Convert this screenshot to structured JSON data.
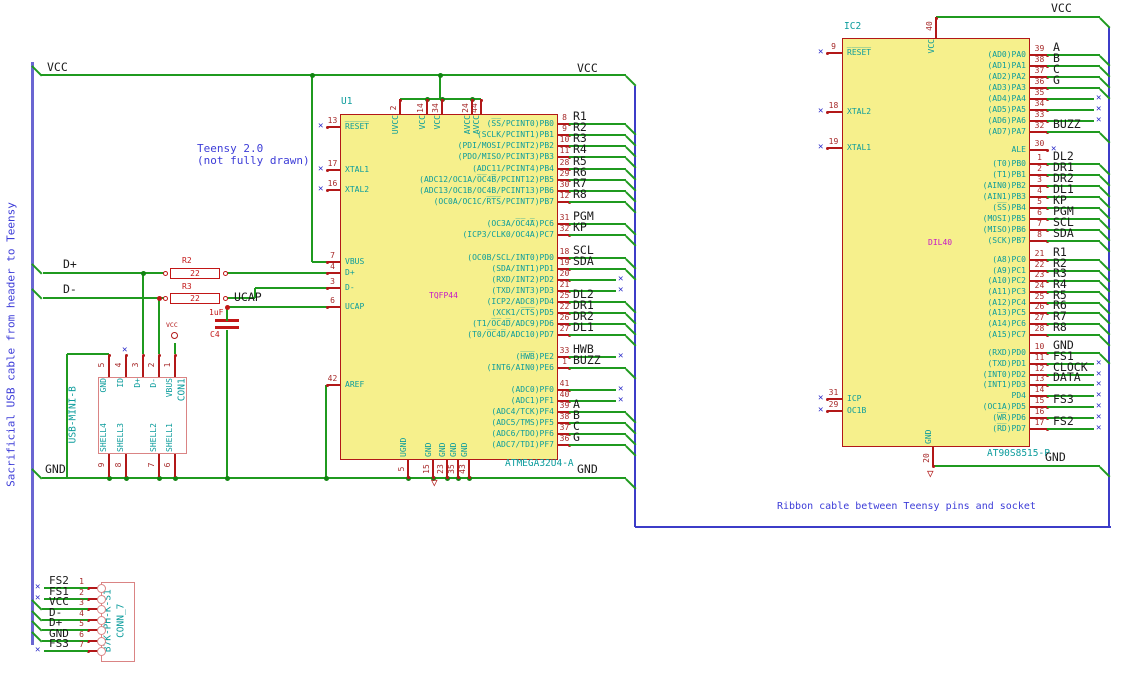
{
  "colors": {
    "wire": "#1f9a1f",
    "junction": "#128412",
    "bus": "#3c3cc8",
    "cable_bus": "#6a66d2",
    "outline": "#b21818",
    "fill": "#f6f08c",
    "pin_name": "#0c9c9c",
    "pin_number": "#a62929",
    "label": "#1a1a1a",
    "note": "#3d3dd8",
    "magenta": "#c617c6",
    "passive": "#c21616",
    "connector": "#da8484",
    "noconnect": "#2a2ac8"
  },
  "notes": {
    "cable": "Sacrificial USB cable from header to Teensy",
    "teensy_line1": "Teensy 2.0",
    "teensy_line2": "(not fully drawn)",
    "ribbon": "Ribbon cable between Teensy pins and socket"
  },
  "net_labels": [
    "VCC",
    "VCC",
    "VCC",
    "GND",
    "GND",
    "GND",
    "D+",
    "D-",
    "UCAP"
  ],
  "u1": {
    "ref": "U1",
    "value": "ATMEGA32U4-A",
    "package": "TQFP44",
    "pins_left": [
      {
        "n": "13",
        "name": "R̅E̅S̅E̅T̅",
        "nc": true
      },
      {
        "n": "17",
        "name": "XTAL1",
        "nc": true
      },
      {
        "n": "16",
        "name": "XTAL2",
        "nc": true
      },
      {
        "n": "7",
        "name": "VBUS"
      },
      {
        "n": "4",
        "name": "D+"
      },
      {
        "n": "3",
        "name": "D-"
      },
      {
        "n": "6",
        "name": "UCAP"
      },
      {
        "n": "42",
        "name": "AREF"
      }
    ],
    "pins_right": [
      {
        "n": "8",
        "name": "(S̅S̅/PCINT0)PB0",
        "label": "R1"
      },
      {
        "n": "9",
        "name": "(SCLK/PCINT1)PB1",
        "label": "R2"
      },
      {
        "n": "10",
        "name": "(PDI/MOSI/PCINT2)PB2",
        "label": "R3"
      },
      {
        "n": "11",
        "name": "(PDO/MISO/PCINT3)PB3",
        "label": "R4"
      },
      {
        "n": "28",
        "name": "(ADC11/PCINT4)PB4",
        "label": "R5"
      },
      {
        "n": "29",
        "name": "(ADC12/OC1A/O̅C̅4̅B̅/PCINT12)PB5",
        "label": "R6"
      },
      {
        "n": "30",
        "name": "(ADC13/OC1B/OC4B/PCINT13)PB6",
        "label": "R7"
      },
      {
        "n": "12",
        "name": "(OC0A/OC1C/R̅T̅S̅/PCINT7)PB7",
        "label": "R8"
      },
      {
        "n": "31",
        "name": "(OC3A/O̅C̅4̅A̅)PC6",
        "label": "PGM"
      },
      {
        "n": "32",
        "name": "(ICP3/CLK0/OC4A)PC7",
        "label": "KP"
      },
      {
        "n": "18",
        "name": "(OC0B/SCL/INT0)PD0",
        "label": "SCL"
      },
      {
        "n": "19",
        "name": "(SDA/INT1)PD1",
        "label": "SDA"
      },
      {
        "n": "20",
        "name": "(RXD/INT2)PD2",
        "nc": true
      },
      {
        "n": "21",
        "name": "(TXD/INT3)PD3",
        "nc": true
      },
      {
        "n": "25",
        "name": "(ICP2/ADC8)PD4",
        "label": "DL2"
      },
      {
        "n": "22",
        "name": "(XCK1/C̅T̅S̅)PD5",
        "label": "DR1"
      },
      {
        "n": "26",
        "name": "(T1/O̅C̅4̅D̅/ADC9)PD6",
        "label": "DR2"
      },
      {
        "n": "27",
        "name": "(T0/O̅C̅4̅D̅/ADC10)PD7",
        "label": "DL1"
      },
      {
        "n": "33",
        "name": "(H̅W̅B̅)PE2",
        "label": "HWB",
        "nc": true
      },
      {
        "n": "1",
        "name": "(INT6/AIN0)PE6",
        "label": "BUZZ"
      },
      {
        "n": "41",
        "name": "(ADC0)PF0",
        "nc": true
      },
      {
        "n": "40",
        "name": "(ADC1)PF1",
        "nc": true
      },
      {
        "n": "39",
        "name": "(ADC4/TCK)PF4",
        "label": "A"
      },
      {
        "n": "38",
        "name": "(ADC5/TMS)PF5",
        "label": "B"
      },
      {
        "n": "37",
        "name": "(ADC6/TDO)PF6",
        "label": "C"
      },
      {
        "n": "36",
        "name": "(ADC7/TDI)PF7",
        "label": "G"
      }
    ],
    "pins_top": [
      {
        "n": "2",
        "name": "UVCC"
      },
      {
        "n": "14",
        "name": "VCC"
      },
      {
        "n": "34",
        "name": "VCC"
      },
      {
        "n": "24",
        "name": "AVCC"
      },
      {
        "n": "44",
        "name": "AVCC"
      }
    ],
    "pins_bottom": [
      {
        "n": "5",
        "name": "UGND"
      },
      {
        "n": "15",
        "name": "GND"
      },
      {
        "n": "23",
        "name": "GND"
      },
      {
        "n": "35",
        "name": "GND"
      },
      {
        "n": "43",
        "name": "GND"
      }
    ]
  },
  "ic2": {
    "ref": "IC2",
    "value": "AT90S8515-P",
    "package": "DIL40",
    "pins_left": [
      {
        "n": "9",
        "name": "R̅E̅S̅E̅T̅",
        "nc": true
      },
      {
        "n": "18",
        "name": "XTAL2",
        "nc": true
      },
      {
        "n": "19",
        "name": "XTAL1",
        "nc": true
      },
      {
        "n": "31",
        "name": "ICP",
        "nc": true
      },
      {
        "n": "29",
        "name": "OC1B",
        "nc": true
      }
    ],
    "pins_top": [
      {
        "n": "40",
        "name": "VCC"
      }
    ],
    "pins_bottom": [
      {
        "n": "20",
        "name": "GND"
      }
    ],
    "pins_right": [
      {
        "n": "39",
        "name": "(AD0)PA0",
        "label": "A"
      },
      {
        "n": "38",
        "name": "(AD1)PA1",
        "label": "B"
      },
      {
        "n": "37",
        "name": "(AD2)PA2",
        "label": "C"
      },
      {
        "n": "36",
        "name": "(AD3)PA3",
        "label": "G"
      },
      {
        "n": "35",
        "name": "(AD4)PA4",
        "nc": true
      },
      {
        "n": "34",
        "name": "(AD5)PA5",
        "nc": true
      },
      {
        "n": "33",
        "name": "(AD6)PA6",
        "nc": true
      },
      {
        "n": "32",
        "name": "(AD7)PA7",
        "label": "BUZZ"
      },
      {
        "n": "30",
        "name": "ALE",
        "nc": true,
        "nc_near": true
      },
      {
        "n": "1",
        "name": "(T0)PB0",
        "label": "DL2"
      },
      {
        "n": "2",
        "name": "(T1)PB1",
        "label": "DR1"
      },
      {
        "n": "3",
        "name": "(AIN0)PB2",
        "label": "DR2"
      },
      {
        "n": "4",
        "name": "(AIN1)PB3",
        "label": "DL1"
      },
      {
        "n": "5",
        "name": "(S̅S̅)PB4",
        "label": "KP"
      },
      {
        "n": "6",
        "name": "(MOSI)PB5",
        "label": "PGM"
      },
      {
        "n": "7",
        "name": "(MISO)PB6",
        "label": "SCL"
      },
      {
        "n": "8",
        "name": "(SCK)PB7",
        "label": "SDA"
      },
      {
        "n": "21",
        "name": "(A8)PC0",
        "label": "R1"
      },
      {
        "n": "22",
        "name": "(A9)PC1",
        "label": "R2"
      },
      {
        "n": "23",
        "name": "(A10)PC2",
        "label": "R3"
      },
      {
        "n": "24",
        "name": "(A11)PC3",
        "label": "R4"
      },
      {
        "n": "25",
        "name": "(A12)PC4",
        "label": "R5"
      },
      {
        "n": "26",
        "name": "(A13)PC5",
        "label": "R6"
      },
      {
        "n": "27",
        "name": "(A14)PC6",
        "label": "R7"
      },
      {
        "n": "28",
        "name": "(A15)PC7",
        "label": "R8"
      },
      {
        "n": "10",
        "name": "(RXD)PD0",
        "label": "GND"
      },
      {
        "n": "11",
        "name": "(TXD)PD1",
        "label": "FS1",
        "nc": true
      },
      {
        "n": "12",
        "name": "(INT0)PD2",
        "label": "CLOCK",
        "nc": true
      },
      {
        "n": "13",
        "name": "(INT1)PD3",
        "label": "DATA",
        "nc": true
      },
      {
        "n": "14",
        "name": "PD4",
        "nc": true
      },
      {
        "n": "15",
        "name": "(OC1A)PD5",
        "label": "FS3",
        "nc": true
      },
      {
        "n": "16",
        "name": "(W̅R̅)PD6",
        "nc": true
      },
      {
        "n": "17",
        "name": "(R̅D̅)PD7",
        "label": "FS2",
        "nc": true
      }
    ]
  },
  "conn1": {
    "ref": "CON1",
    "value": "USB-MINI-B",
    "vbus_net": "VCC",
    "pins_top": [
      {
        "n": "5",
        "name": "GND"
      },
      {
        "n": "4",
        "name": "ID",
        "nc": true
      },
      {
        "n": "3",
        "name": "D+"
      },
      {
        "n": "2",
        "name": "D-"
      },
      {
        "n": "1",
        "name": "VBUS"
      }
    ],
    "pins_bottom": [
      {
        "n": "9",
        "name": "SHELL4"
      },
      {
        "n": "8",
        "name": "SHELL3"
      },
      {
        "n": "7",
        "name": "SHELL2"
      },
      {
        "n": "6",
        "name": "SHELL1"
      }
    ]
  },
  "conn7": {
    "ref": "CONN_7",
    "value": "B7K-PH-K-S1",
    "rows": [
      {
        "n": "1",
        "label": "FS2",
        "nc": true
      },
      {
        "n": "2",
        "label": "FS1",
        "nc": true
      },
      {
        "n": "3",
        "label": "VCC"
      },
      {
        "n": "4",
        "label": "D-"
      },
      {
        "n": "5",
        "label": "D+"
      },
      {
        "n": "6",
        "label": "GND"
      },
      {
        "n": "7",
        "label": "FS3",
        "nc": true
      }
    ]
  },
  "r2": {
    "ref": "R2",
    "value": "22"
  },
  "r3": {
    "ref": "R3",
    "value": "22"
  },
  "c4": {
    "ref": "C4",
    "value": "1uF"
  }
}
